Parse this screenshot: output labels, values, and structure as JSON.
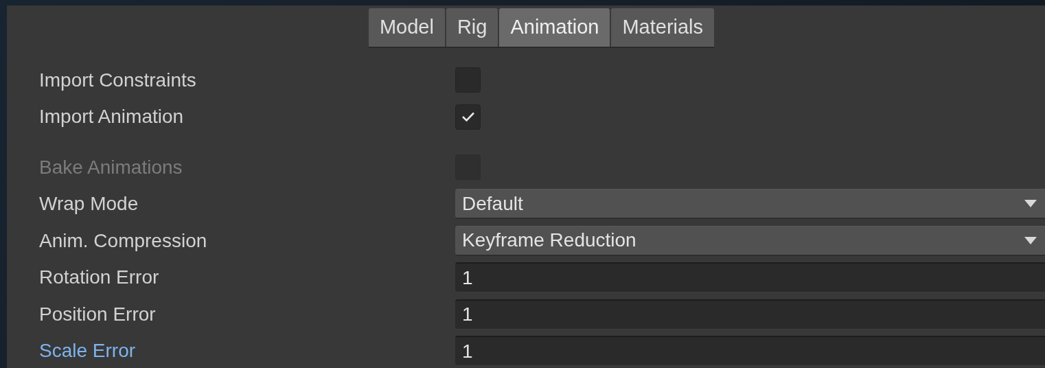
{
  "tabs": [
    {
      "label": "Model",
      "selected": false
    },
    {
      "label": "Rig",
      "selected": false
    },
    {
      "label": "Animation",
      "selected": true
    },
    {
      "label": "Materials",
      "selected": false
    }
  ],
  "rows": [
    {
      "kind": "checkbox",
      "label": "Import Constraints",
      "checked": false,
      "disabled": false,
      "overridden": false
    },
    {
      "kind": "checkbox",
      "label": "Import Animation",
      "checked": true,
      "disabled": false,
      "overridden": false
    },
    {
      "kind": "checkbox",
      "label": "Bake Animations",
      "checked": false,
      "disabled": true,
      "overridden": false
    },
    {
      "kind": "dropdown",
      "label": "Wrap Mode",
      "value": "Default",
      "disabled": false,
      "overridden": false
    },
    {
      "kind": "dropdown",
      "label": "Anim. Compression",
      "value": "Keyframe Reduction",
      "disabled": false,
      "overridden": false
    },
    {
      "kind": "number",
      "label": "Rotation Error",
      "value": "1",
      "disabled": false,
      "overridden": false
    },
    {
      "kind": "number",
      "label": "Position Error",
      "value": "1",
      "disabled": false,
      "overridden": false
    },
    {
      "kind": "number",
      "label": "Scale Error",
      "value": "1",
      "disabled": false,
      "overridden": true
    }
  ]
}
